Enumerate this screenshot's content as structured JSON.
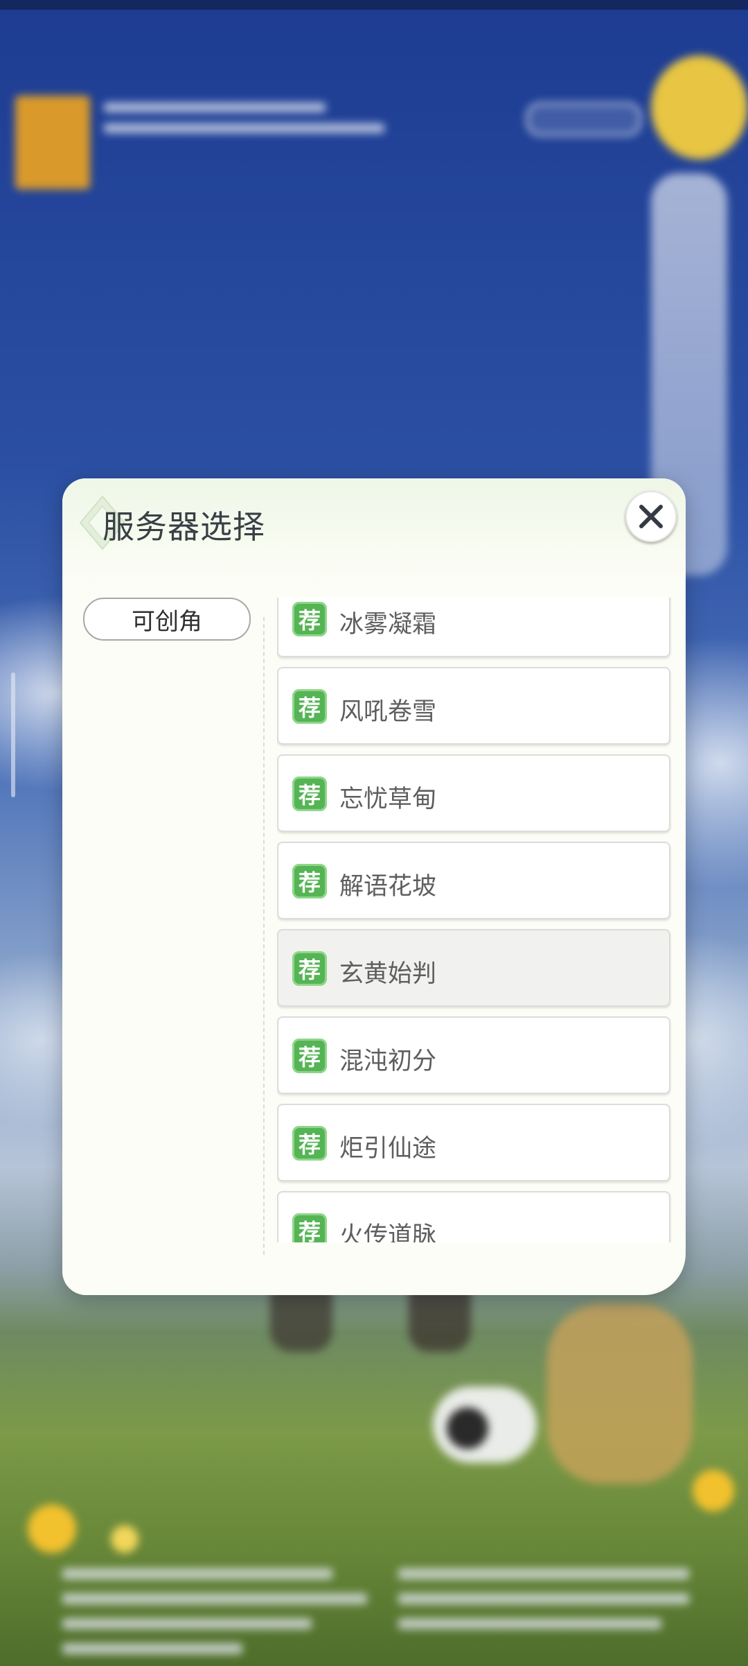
{
  "dialog": {
    "title": "服务器选择",
    "close_icon": "close-icon",
    "header_icon": "diamond-emblem-icon"
  },
  "categories": [
    {
      "label": "可创角",
      "selected": true
    }
  ],
  "servers": [
    {
      "badge": "荐",
      "name": "冰雾凝霜",
      "selected": false
    },
    {
      "badge": "荐",
      "name": "风吼卷雪",
      "selected": false
    },
    {
      "badge": "荐",
      "name": "忘忧草甸",
      "selected": false
    },
    {
      "badge": "荐",
      "name": "解语花坡",
      "selected": false
    },
    {
      "badge": "荐",
      "name": "玄黄始判",
      "selected": true
    },
    {
      "badge": "荐",
      "name": "混沌初分",
      "selected": false
    },
    {
      "badge": "荐",
      "name": "炬引仙途",
      "selected": false
    },
    {
      "badge": "荐",
      "name": "火传道脉",
      "selected": false
    }
  ],
  "colors": {
    "badge_green": "#55b454",
    "dialog_bg": "#fcfdf6",
    "selected_item_bg": "#f1f1ef"
  }
}
